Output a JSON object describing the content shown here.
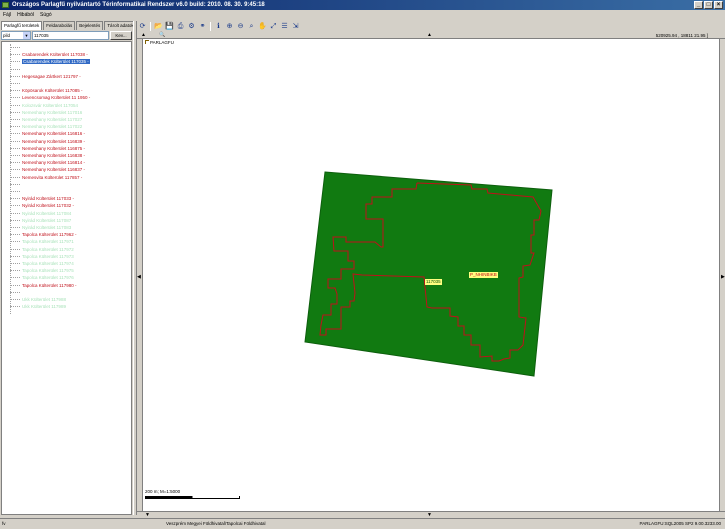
{
  "window": {
    "title": "Országos Parlagfű nyilvántartó Térinformatikai Rendszer v6.0 build: 2010. 08. 30. 9:45:18"
  },
  "menu": [
    "Fájl",
    "Hibából",
    "Súgó"
  ],
  "tabs": [
    {
      "label": "Parlagfű területek",
      "active": true
    },
    {
      "label": "Feldarabolás",
      "active": false
    },
    {
      "label": "Bejelentés",
      "active": false
    },
    {
      "label": "Tárolt adatok",
      "active": false
    }
  ],
  "search": {
    "field_value": "pild",
    "query": "117035",
    "button_label": "Kev..."
  },
  "tree_items": [
    {
      "label": "",
      "color": "#a9e2ba"
    },
    {
      "label": "Csabarendek Külterület 117038 -",
      "color": "#c0101a"
    },
    {
      "label": "Csabarendek Külterület 117035 -",
      "color": "#ffffff",
      "selected": true
    },
    {
      "label": "",
      "color": "#a9e2ba"
    },
    {
      "label": "Hegesagae Zártkert 121797 -",
      "color": "#c0101a"
    },
    {
      "label": "",
      "color": "#a9e2ba"
    },
    {
      "label": "Köpösarok Külterület 117085 -",
      "color": "#c0101a"
    },
    {
      "label": "Levencsomag Külterület 11 1950 -",
      "color": "#c0101a"
    },
    {
      "label": "Kolozsvár Külterület 117054",
      "color": "#a9e2ba"
    },
    {
      "label": "Nemeshany Külterület 117016",
      "color": "#a9e2ba"
    },
    {
      "label": "Nemeshany Külterület 117027",
      "color": "#a9e2ba"
    },
    {
      "label": "Nemeshany Külterület 117022",
      "color": "#a9e2ba"
    },
    {
      "label": "Nemeshany Külterület 116816 -",
      "color": "#c0101a"
    },
    {
      "label": "Nemeshany Külterület 116839 -",
      "color": "#c0101a"
    },
    {
      "label": "Nemeshany Külterület 116875 -",
      "color": "#c0101a"
    },
    {
      "label": "Nemeshany Külterület 116838 -",
      "color": "#c0101a"
    },
    {
      "label": "Nemeshany Külterület 116814 -",
      "color": "#c0101a"
    },
    {
      "label": "Nemeshany Külterület 116837 -",
      "color": "#c0101a"
    },
    {
      "label": "Nemesvita Külterület 117857 -",
      "color": "#c0101a"
    },
    {
      "label": "",
      "color": "#a9e2ba"
    },
    {
      "label": "",
      "color": "#a9e2ba"
    },
    {
      "label": "Nyirád Külterület 117033 -",
      "color": "#c0101a"
    },
    {
      "label": "Nyirád Külterület 117032 -",
      "color": "#c0101a"
    },
    {
      "label": "Nyirád Külterület 117084",
      "color": "#a9e2ba"
    },
    {
      "label": "Nyirád Külterület 117087",
      "color": "#a9e2ba"
    },
    {
      "label": "Nyirád Külterület 117083",
      "color": "#a9e2ba"
    },
    {
      "label": "Tapolca Külterület 117962 -",
      "color": "#c0101a"
    },
    {
      "label": "Tapolca Külterület 117971",
      "color": "#a9e2ba"
    },
    {
      "label": "Tapolca Külterület 117972",
      "color": "#a9e2ba"
    },
    {
      "label": "Tapolca Külterület 117973",
      "color": "#a9e2ba"
    },
    {
      "label": "Tapolca Külterület 117974",
      "color": "#a9e2ba"
    },
    {
      "label": "Tapolca Külterület 117975",
      "color": "#a9e2ba"
    },
    {
      "label": "Tapolca Külterület 117976",
      "color": "#a9e2ba"
    },
    {
      "label": "Tapolca Külterület 117980 -",
      "color": "#c0101a"
    },
    {
      "label": "",
      "color": "#a9e2ba"
    },
    {
      "label": "Ukk Külterület 117988",
      "color": "#a9e2ba"
    },
    {
      "label": "Ukk Külterület 117989",
      "color": "#a9e2ba"
    }
  ],
  "toolbar_icons": [
    "refresh-icon",
    "open-folder-icon",
    "save-icon",
    "print-icon",
    "settings-icon",
    "binoculars-icon",
    "info-icon",
    "zoom-in-icon",
    "zoom-out-icon",
    "zoom-window-icon",
    "pan-hand-icon",
    "zoom-extent-icon",
    "layers-icon",
    "export-icon"
  ],
  "map": {
    "coords": "520925.94 , 18811 21.95 ]",
    "layer_label": "PARLAGFU",
    "parcel_label": "117035",
    "infested_label": "P_NHINBIKB",
    "scale_label": "200 m; M=1:5000",
    "parcel_fill": "#117a11",
    "outline_color": "#c0101a",
    "label_bg": "#ffff80"
  },
  "status": {
    "left": "fv",
    "middle": "Veszprém Megyei Földhivatal\\Tapolcai Földhivatal",
    "right": "PARLAGFU:SQL2005 SP2 9.00.3233.00"
  }
}
